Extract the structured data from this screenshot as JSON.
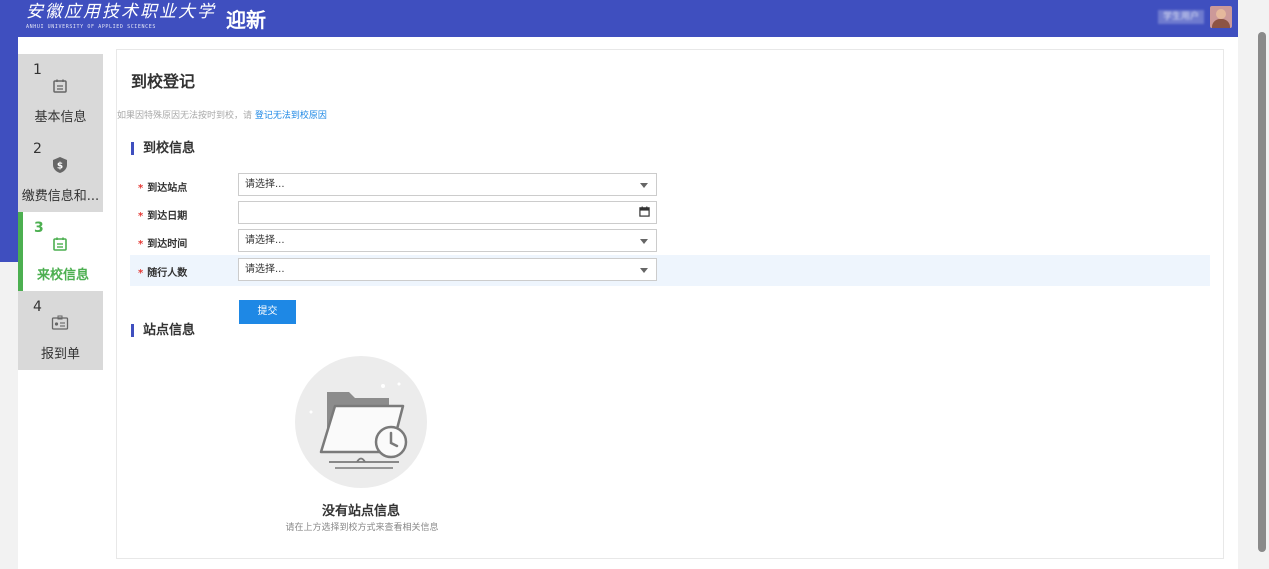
{
  "header": {
    "school_name_cn": "安徽应用技术职业大学",
    "school_name_en": "ANHUI UNIVERSITY OF APPLIED SCIENCES",
    "app_title": "迎新",
    "user_name": "学生用户"
  },
  "steps": [
    {
      "num": "1",
      "label": "基本信息",
      "icon": "calendar-icon",
      "active": false
    },
    {
      "num": "2",
      "label": "缴费信息和...",
      "icon": "shield-money-icon",
      "active": false
    },
    {
      "num": "3",
      "label": "来校信息",
      "icon": "calendar-icon",
      "active": true
    },
    {
      "num": "4",
      "label": "报到单",
      "icon": "id-card-icon",
      "active": false
    }
  ],
  "main": {
    "title": "到校登记",
    "notice_text": "如果因特殊原因无法按时到校，请 ",
    "notice_link": "登记无法到校原因",
    "arrival_section": "到校信息",
    "fields": [
      {
        "label": "到达站点",
        "value": "请选择...",
        "type": "select"
      },
      {
        "label": "到达日期",
        "value": "",
        "type": "date"
      },
      {
        "label": "到达时间",
        "value": "请选择...",
        "type": "select"
      },
      {
        "label": "随行人数",
        "value": "请选择...",
        "type": "select"
      }
    ],
    "submit_label": "提交",
    "station_section": "站点信息",
    "empty_title": "没有站点信息",
    "empty_subtitle": "请在上方选择到校方式来查看相关信息"
  },
  "colors": {
    "header_bg": "#3f4fbf",
    "active_step": "#4caf50",
    "primary_button": "#1e88e5",
    "required": "#e53935"
  }
}
